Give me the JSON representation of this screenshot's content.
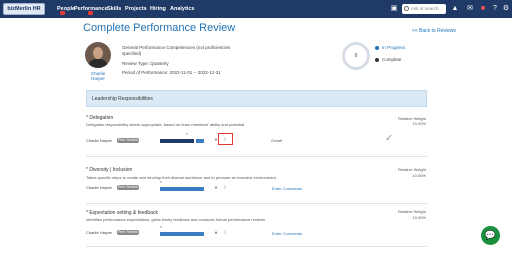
{
  "nav": {
    "logo": "bizMerlin HR",
    "items": [
      "People",
      "Performance",
      "Skills",
      "Projects",
      "Hiring",
      "Analytics"
    ],
    "search_placeholder": "Ask or search",
    "icons": [
      "calendar-icon",
      "graduation-icon",
      "mail-icon",
      "alert-icon",
      "help-icon",
      "settings-icon",
      "user-icon"
    ],
    "accent": "#1f3a66"
  },
  "page": {
    "title": "Complete Performance Review",
    "back": "<< Back to Reviews"
  },
  "profile": {
    "name": "Charlie Harper",
    "template": "General Performance Competencies (not proficiencies specified)",
    "review_type": "Review Type: Quarterly",
    "period": "Period of Performance: 2022-11-01 -- 2022-12-31"
  },
  "progress": {
    "count": "6",
    "legend": [
      "In Progress",
      "Complete"
    ],
    "colors": [
      "#1f73b7",
      "#333333"
    ]
  },
  "section": {
    "title": "Leadership Responsibilities"
  },
  "competencies": [
    {
      "title": "* Delegation",
      "desc": "Delegates responsibility where appropriate, based on team members' ability and potential.",
      "weight_label": "Relative Weight",
      "weight": "10.00%",
      "person": "Charlie Harper",
      "badge": "Peer Review",
      "note": "Great!",
      "rating_max": "5"
    },
    {
      "title": "* Diversity | Inclusion",
      "desc": "Takes specific steps to create and develop their diverse workforce and to promote an inclusive environment.",
      "weight_label": "Relative Weight",
      "weight": "10.00%",
      "person": "Charlie Harper",
      "badge": "Peer Review",
      "note": "Enter Comments",
      "rating_max": "5"
    },
    {
      "title": "* Expectation setting & feedback",
      "desc": "Identifies performance expectations, gives timely feedback and conducts formal performance reviews.",
      "weight_label": "Relative Weight",
      "weight": "10.00%",
      "person": "Charlie Harper",
      "badge": "Peer Review",
      "note": "Enter Comments",
      "rating_max": "5"
    }
  ]
}
